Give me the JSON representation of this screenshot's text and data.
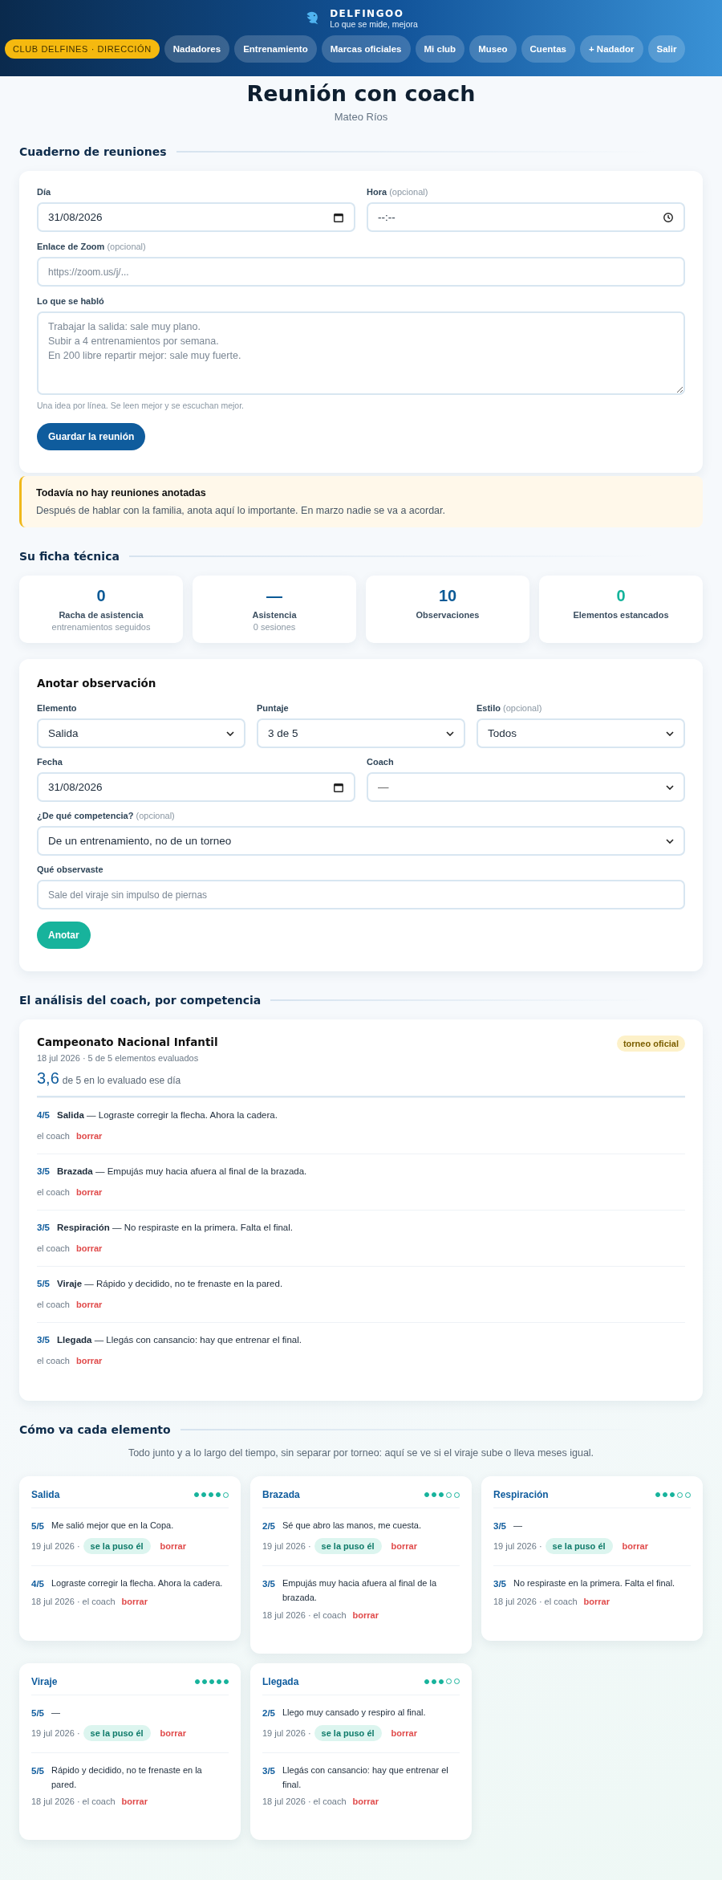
{
  "header": {
    "brand": "DELFINGOO",
    "tagline": "Lo que se mide, mejora",
    "club_badge": "CLUB DELFINES · DIRECCIÓN",
    "nav": [
      "Nadadores",
      "Entrenamiento",
      "Marcas oficiales",
      "Mi club",
      "Museo",
      "Cuentas",
      "+ Nadador",
      "Salir"
    ]
  },
  "page": {
    "title": "Reunión con coach",
    "subtitle": "Mateo Ríos"
  },
  "meetings": {
    "heading": "Cuaderno de reuniones",
    "day": {
      "label": "Día",
      "value": "31/08/2026"
    },
    "time": {
      "label": "Hora",
      "hint": "(opcional)",
      "value": "--:--"
    },
    "zoom": {
      "label": "Enlace de Zoom",
      "hint": "(opcional)",
      "placeholder": "https://zoom.us/j/..."
    },
    "notes": {
      "label": "Lo que se habló",
      "placeholder": "Trabajar la salida: sale muy plano.\nSubir a 4 entrenamientos por semana.\nEn 200 libre repartir mejor: sale muy fuerte.",
      "help": "Una idea por línea. Se leen mejor y se escuchan mejor."
    },
    "button": "Guardar la reunión",
    "notice": {
      "title": "Todavía no hay reuniones anotadas",
      "text": "Después de hablar con la familia, anota aquí lo importante. En marzo nadie se va a acordar."
    }
  },
  "profile": {
    "heading": "Su ficha técnica",
    "stats": [
      {
        "value": "0",
        "label": "Racha de asistencia",
        "sub": "entrenamientos seguidos",
        "color": "#0b5a96"
      },
      {
        "value": "—",
        "label": "Asistencia",
        "sub": "0 sesiones",
        "color": "#0b5a96"
      },
      {
        "value": "10",
        "label": "Observaciones",
        "color": "#0b5a96"
      },
      {
        "value": "0",
        "label": "Elementos estancados",
        "color": "#14b39b"
      }
    ]
  },
  "observation": {
    "title": "Anotar observación",
    "element": {
      "label": "Elemento",
      "value": "Salida"
    },
    "score": {
      "label": "Puntaje",
      "value": "3 de 5"
    },
    "style": {
      "label": "Estilo",
      "hint": "(opcional)",
      "value": "Todos"
    },
    "date": {
      "label": "Fecha",
      "value": "31/08/2026"
    },
    "coach": {
      "label": "Coach",
      "value": "—"
    },
    "competition": {
      "label": "¿De qué competencia?",
      "hint": "(opcional)",
      "value": "De un entrenamiento, no de un torneo"
    },
    "what": {
      "label": "Qué observaste",
      "placeholder": "Sale del viraje sin impulso de piernas"
    },
    "button": "Anotar"
  },
  "analysis": {
    "heading": "El análisis del coach, por competencia",
    "competitions": [
      {
        "name": "Campeonato Nacional Infantil",
        "badge": "torneo oficial",
        "meta": "18 jul 2026 · 5 de 5 elementos evaluados",
        "average": "3,6",
        "average_text": "de 5 en lo evaluado ese día",
        "rows": [
          {
            "score": "4/5",
            "text": "**Salida** — Lograste corregir la flecha. Ahora la cadera.",
            "by": "el coach",
            "action": "borrar"
          },
          {
            "score": "3/5",
            "text": "**Brazada** — Empujás muy hacia afuera al final de la brazada.",
            "by": "el coach",
            "action": "borrar"
          },
          {
            "score": "3/5",
            "text": "**Respiración** — No respiraste en la primera. Falta el final.",
            "by": "el coach",
            "action": "borrar"
          },
          {
            "score": "5/5",
            "text": "**Viraje** — Rápido y decidido, no te frenaste en la pared.",
            "by": "el coach",
            "action": "borrar"
          },
          {
            "score": "3/5",
            "text": "**Llegada** — Llegás con cansancio: hay que entrenar el final.",
            "by": "el coach",
            "action": "borrar"
          }
        ]
      }
    ]
  },
  "elements": {
    "heading": "Cómo va cada elemento",
    "intro": "Todo junto y a lo largo del tiempo, sin separar por torneo: aquí se ve si el viraje sube o lleva meses igual.",
    "cards": [
      {
        "name": "Salida",
        "stars": 4,
        "entries": [
          {
            "kind": "self",
            "score": "5/5",
            "text": "Me salió mejor que en la Copa.",
            "date": "19 jul 2026 ·",
            "badge": "se la puso él",
            "action": "borrar"
          },
          {
            "kind": "coach",
            "score": "4/5",
            "text": "Lograste corregir la flecha. Ahora la cadera.",
            "meta": "18 jul 2026 · el coach",
            "action": "borrar"
          }
        ]
      },
      {
        "name": "Brazada",
        "stars": 3,
        "entries": [
          {
            "kind": "self",
            "score": "2/5",
            "text": "Sé que abro las manos, me cuesta.",
            "date": "19 jul 2026 ·",
            "badge": "se la puso él",
            "action": "borrar"
          },
          {
            "kind": "coach",
            "score": "3/5",
            "text": "Empujás muy hacia afuera al final de la brazada.",
            "meta": "18 jul 2026 · el coach",
            "action": "borrar"
          }
        ]
      },
      {
        "name": "Respiración",
        "stars": 3,
        "entries": [
          {
            "kind": "self",
            "score": "3/5",
            "text": "—",
            "date": "19 jul 2026 ·",
            "badge": "se la puso él",
            "action": "borrar"
          },
          {
            "kind": "coach",
            "score": "3/5",
            "text": "No respiraste en la primera. Falta el final.",
            "meta": "18 jul 2026 · el coach",
            "action": "borrar"
          }
        ]
      },
      {
        "name": "Viraje",
        "stars": 5,
        "entries": [
          {
            "kind": "self",
            "score": "5/5",
            "text": "—",
            "date": "19 jul 2026 ·",
            "badge": "se la puso él",
            "action": "borrar"
          },
          {
            "kind": "coach",
            "score": "5/5",
            "text": "Rápido y decidido, no te frenaste en la pared.",
            "meta": "18 jul 2026 · el coach",
            "action": "borrar"
          }
        ]
      },
      {
        "name": "Llegada",
        "stars": 3,
        "entries": [
          {
            "kind": "self",
            "score": "2/5",
            "text": "Llego muy cansado y respiro al final.",
            "date": "19 jul 2026 ·",
            "badge": "se la puso él",
            "action": "borrar"
          },
          {
            "kind": "coach",
            "score": "3/5",
            "text": "Llegás con cansancio: hay que entrenar el final.",
            "meta": "18 jul 2026 · el coach",
            "action": "borrar"
          }
        ]
      }
    ]
  }
}
